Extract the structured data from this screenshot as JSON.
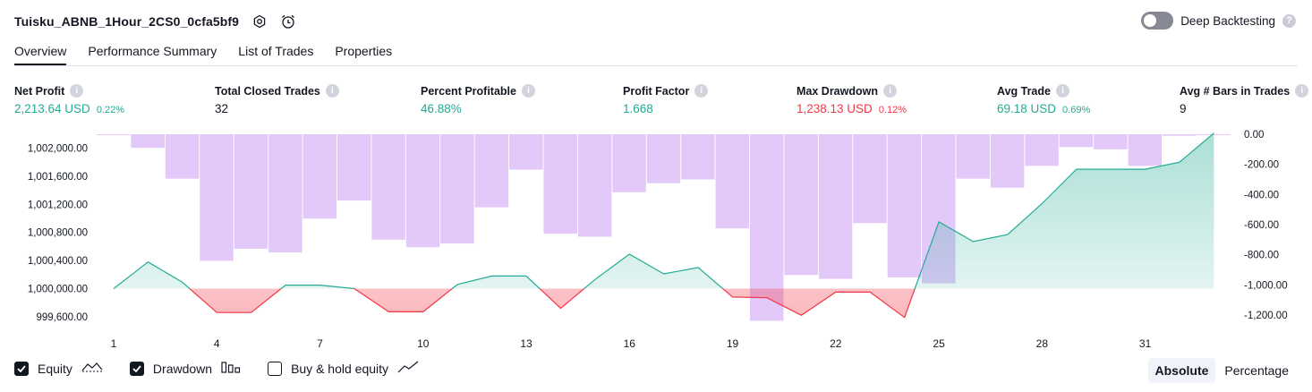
{
  "header": {
    "title": "Tuisku_ABNB_1Hour_2CS0_0cfa5bf9",
    "icons": [
      "settings-icon",
      "alarm-add-icon"
    ],
    "deep_backtesting_label": "Deep Backtesting",
    "deep_backtesting_on": false
  },
  "tabs": [
    {
      "label": "Overview",
      "active": true
    },
    {
      "label": "Performance Summary",
      "active": false
    },
    {
      "label": "List of Trades",
      "active": false
    },
    {
      "label": "Properties",
      "active": false
    }
  ],
  "metrics": {
    "net_profit": {
      "label": "Net Profit",
      "value": "2,213.64 USD",
      "pct": "0.22%"
    },
    "total_closed_trades": {
      "label": "Total Closed Trades",
      "value": "32"
    },
    "percent_profitable": {
      "label": "Percent Profitable",
      "value": "46.88%"
    },
    "profit_factor": {
      "label": "Profit Factor",
      "value": "1.668"
    },
    "max_drawdown": {
      "label": "Max Drawdown",
      "value": "1,238.13 USD",
      "pct": "0.12%"
    },
    "avg_trade": {
      "label": "Avg Trade",
      "value": "69.18 USD",
      "pct": "0.69%"
    },
    "avg_bars": {
      "label": "Avg # Bars in Trades",
      "value": "9"
    }
  },
  "chart_data": {
    "type": "line",
    "left_axis": {
      "ticks": [
        "1,002,000.00",
        "1,001,600.00",
        "1,001,200.00",
        "1,000,800.00",
        "1,000,400.00",
        "1,000,000.00",
        "999,600.00"
      ],
      "values": [
        1002000,
        1001600,
        1001200,
        1000800,
        1000400,
        1000000,
        999600
      ]
    },
    "right_axis": {
      "ticks": [
        "0.00",
        "-200.00",
        "-400.00",
        "-600.00",
        "-800.00",
        "-1,000.00",
        "-1,200.00"
      ],
      "values": [
        0,
        -200,
        -400,
        -600,
        -800,
        -1000,
        -1200
      ]
    },
    "x_ticks": [
      "1",
      "4",
      "7",
      "10",
      "13",
      "16",
      "19",
      "22",
      "25",
      "28",
      "31"
    ],
    "x": [
      1,
      2,
      3,
      4,
      5,
      6,
      7,
      8,
      9,
      10,
      11,
      12,
      13,
      14,
      15,
      16,
      17,
      18,
      19,
      20,
      21,
      22,
      23,
      24,
      25,
      26,
      27,
      28,
      29,
      30,
      31,
      32,
      33
    ],
    "series": [
      {
        "name": "Equity",
        "color": "#22ab94",
        "values": [
          1000000,
          1000380,
          1000090,
          999660,
          999660,
          1000050,
          1000050,
          1000000,
          999670,
          999670,
          1000060,
          1000180,
          1000180,
          999720,
          1000130,
          1000490,
          1000210,
          1000300,
          999880,
          999870,
          999620,
          999950,
          999950,
          999590,
          1000950,
          1000670,
          1000770,
          1001210,
          1001700,
          1001700,
          1001700,
          1001800,
          1002213.64
        ]
      },
      {
        "name": "Drawdown",
        "color": "#e1bee7",
        "values": [
          -5,
          -90,
          -295,
          -840,
          -760,
          -785,
          -560,
          -440,
          -700,
          -750,
          -725,
          -485,
          -235,
          -660,
          -680,
          -385,
          -325,
          -300,
          -625,
          -1238.13,
          -935,
          -960,
          -590,
          -950,
          -990,
          -295,
          -355,
          -210,
          -85,
          -100,
          -210,
          -10,
          0
        ]
      },
      {
        "name": "Buy & hold equity",
        "visible": false
      }
    ],
    "grid": false,
    "legend": "bottom-left",
    "colors": {
      "profit": "#22ab94",
      "loss": "#f23645",
      "drawdown": "#e1bee7"
    }
  },
  "legend": {
    "equity_label": "Equity",
    "equity_on": true,
    "drawdown_label": "Drawdown",
    "drawdown_on": true,
    "buyhold_label": "Buy & hold equity",
    "buyhold_on": false
  },
  "modes": {
    "absolute_label": "Absolute",
    "percentage_label": "Percentage",
    "selected": "Absolute"
  }
}
